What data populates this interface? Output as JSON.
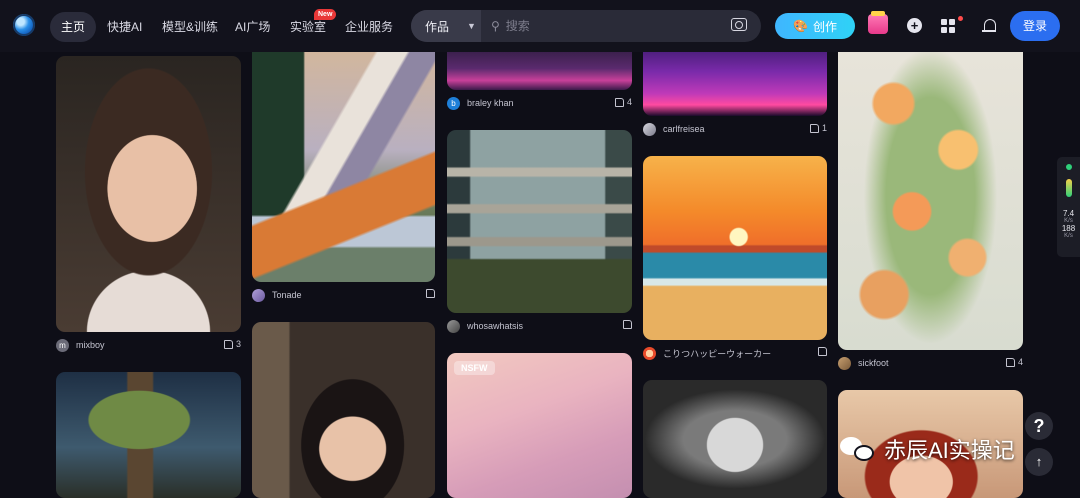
{
  "nav": {
    "items": [
      "主页",
      "快捷AI",
      "模型&训练",
      "AI广场",
      "实验室",
      "企业服务"
    ],
    "new_badge": "New",
    "search_type": "作品",
    "search_placeholder": "搜索",
    "create_label": "创作",
    "login_label": "登录"
  },
  "cards": [
    {
      "user": "mixboy",
      "likes": "3",
      "avatar_letter": "m"
    },
    {
      "user": "Tonade",
      "likes": ""
    },
    {
      "user": "braley khan",
      "likes": "4",
      "avatar_letter": "b"
    },
    {
      "user": "whosawhatsis",
      "likes": ""
    },
    {
      "user": "carlfreisea",
      "likes": "1"
    },
    {
      "user": "こりつハッピーウォーカー",
      "likes": ""
    },
    {
      "user": "sickfoot",
      "likes": "4"
    }
  ],
  "nsfw_label": "NSFW",
  "speed": {
    "up": "7.4",
    "up_unit": "K/s",
    "down": "188",
    "down_unit": "K/s"
  },
  "help_label": "?",
  "watermark": "赤辰AI实操记",
  "colors": {
    "accent": "#2b6ef0",
    "create_gradient_start": "#3fb6ff",
    "background": "#0e0e17"
  }
}
